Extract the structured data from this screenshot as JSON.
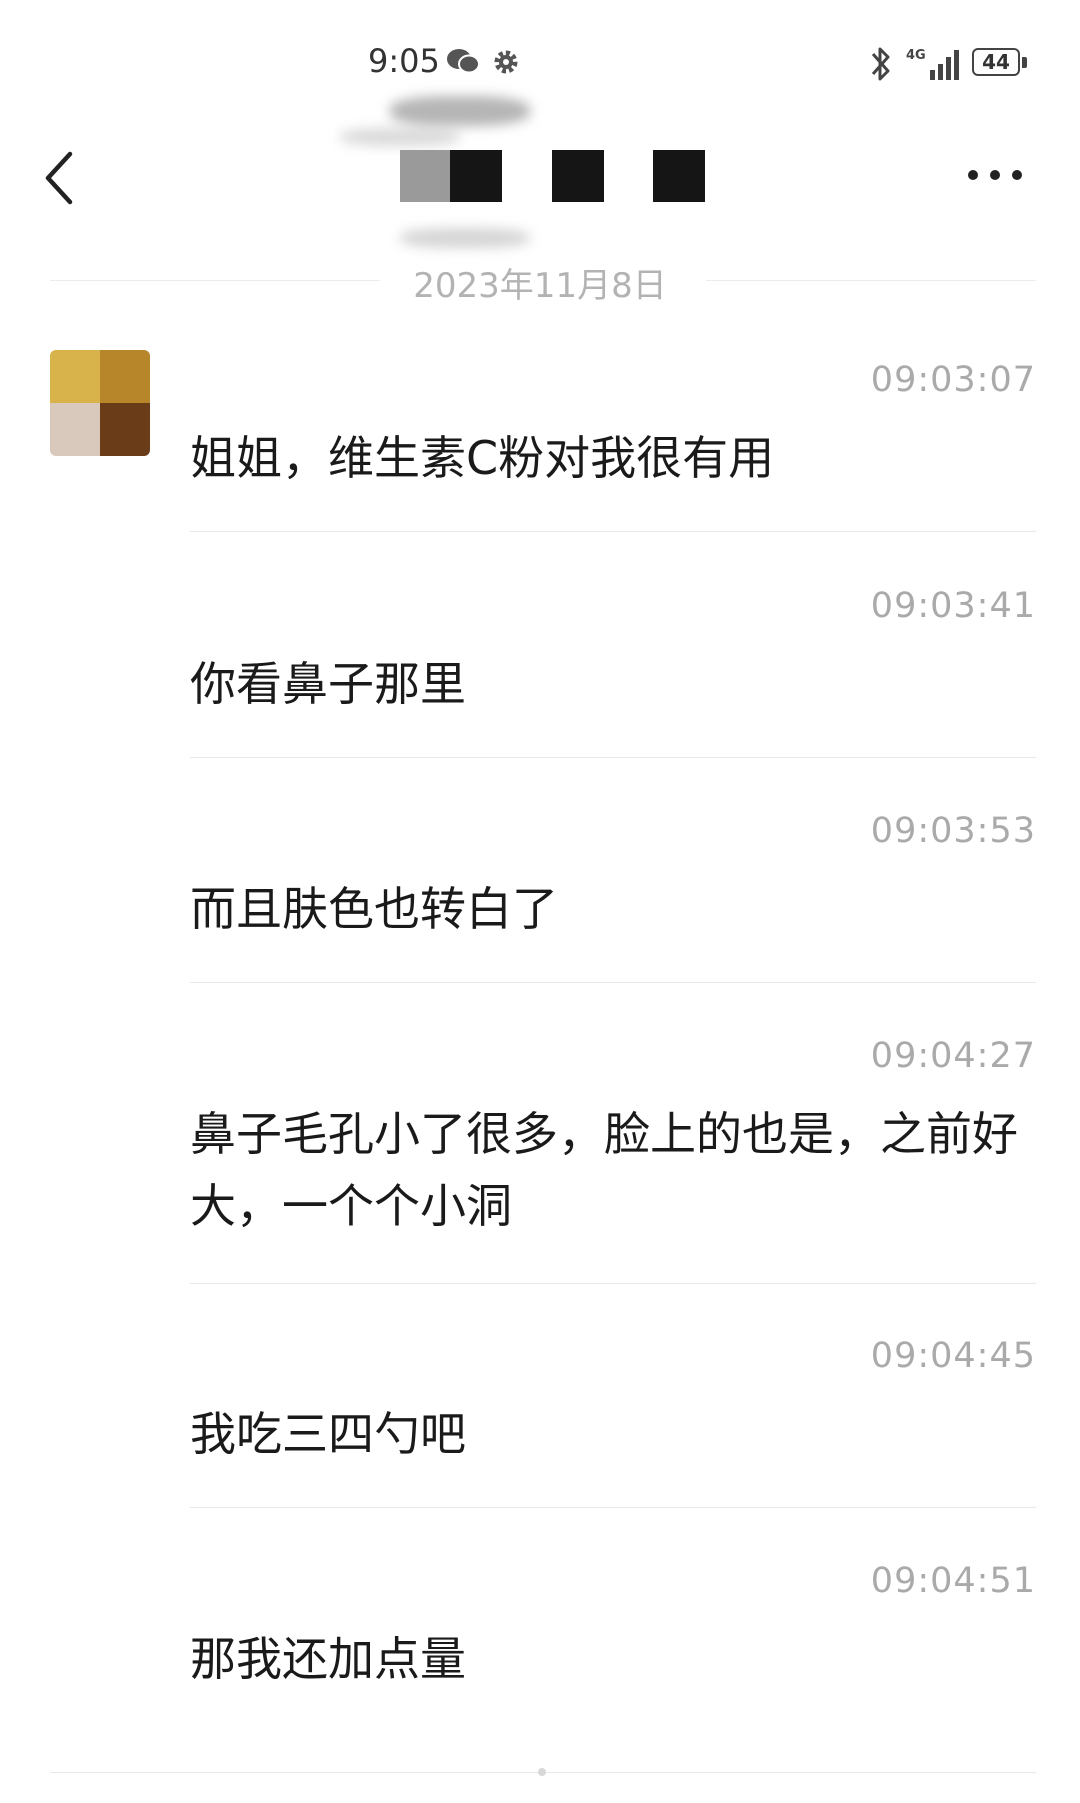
{
  "status_bar": {
    "time": "9:05",
    "network_label": "4G",
    "battery": "44",
    "icons": [
      "wechat-icon",
      "gear-icon",
      "bluetooth-icon",
      "signal-icon",
      "battery-icon"
    ]
  },
  "header": {
    "title_redacted": true,
    "back_icon": "chevron-left-icon",
    "more_icon": "more-dots-icon"
  },
  "date_divider": "2023年11月8日",
  "messages": [
    {
      "time": "09:03:07",
      "text": "姐姐，维生素C粉对我很有用"
    },
    {
      "time": "09:03:41",
      "text": "你看鼻子那里"
    },
    {
      "time": "09:03:53",
      "text": "而且肤色也转白了"
    },
    {
      "time": "09:04:27",
      "text": "鼻子毛孔小了很多，脸上的也是，之前好大，一个个小洞"
    },
    {
      "time": "09:04:45",
      "text": "我吃三四勺吧"
    },
    {
      "time": "09:04:51",
      "text": "那我还加点量"
    }
  ],
  "colors": {
    "background": "#ffffff",
    "text": "#1a1a1a",
    "timestamp": "#aaaaaa",
    "divider": "#e8e8e8",
    "avatar": [
      "#d8b24a",
      "#b8862a",
      "#d9c9bd",
      "#6b3c18"
    ]
  }
}
